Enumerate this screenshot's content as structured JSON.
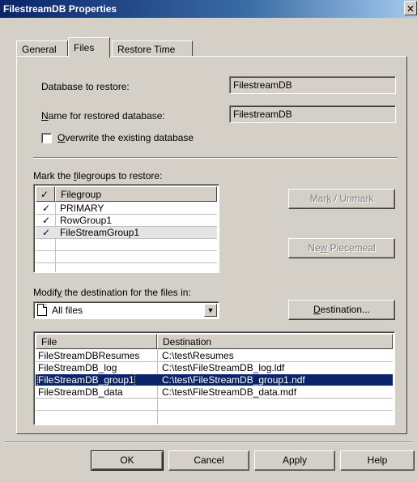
{
  "window": {
    "title": "FilestreamDB Properties",
    "close_label": "✕"
  },
  "tabs": [
    {
      "label": "General"
    },
    {
      "label": "Files"
    },
    {
      "label": "Restore Time"
    }
  ],
  "form": {
    "db_restore_label": "Database to restore:",
    "db_restore_value": "FilestreamDB",
    "name_label_prefix": "",
    "name_label_underline": "N",
    "name_label_rest": "ame for restored database:",
    "name_value": "FilestreamDB",
    "overwrite_underline": "O",
    "overwrite_rest": "verwrite the existing database",
    "overwrite_checked": false
  },
  "filegroups": {
    "label_pre": "Mark the ",
    "label_underline": "f",
    "label_rest": "ilegroups to restore:",
    "check_header": "✓",
    "column_header": "Filegroup",
    "rows": [
      {
        "checked": "✓",
        "name": "PRIMARY"
      },
      {
        "checked": "✓",
        "name": "RowGroup1"
      },
      {
        "checked": "✓",
        "name": "FileStreamGroup1"
      }
    ]
  },
  "buttons": {
    "mark_pre": "Mar",
    "mark_underline": "k",
    "mark_rest": " / Unmark",
    "piecemeal_pre": "Ne",
    "piecemeal_underline": "w",
    "piecemeal_rest": " Piecemeal",
    "destination_underline": "D",
    "destination_rest": "estination...",
    "ok": "OK",
    "cancel": "Cancel",
    "apply": "Apply",
    "help": "Help"
  },
  "destination": {
    "label_pre": "Modif",
    "label_underline": "y",
    "label_rest": " the destination for the files in:",
    "combo_value": "All files",
    "combo_arrow": "▼"
  },
  "files_table": {
    "headers": [
      "File",
      "Destination"
    ],
    "rows": [
      {
        "file": "FileStreamDBResumes",
        "dest": "C:\\test\\Resumes"
      },
      {
        "file": "FileStreamDB_log",
        "dest": "C:\\test\\FileStreamDB_log.ldf"
      },
      {
        "file": "FileStreamDB_group1",
        "dest": "C:\\test\\FileStreamDB_group1.ndf"
      },
      {
        "file": "FileStreamDB_data",
        "dest": "C:\\test\\FileStreamDB_data.mdf"
      }
    ],
    "selected_index": 2
  },
  "colors": {
    "selection": "#0a246a",
    "titlebar": "#0a246a",
    "face": "#d4d0c8"
  }
}
